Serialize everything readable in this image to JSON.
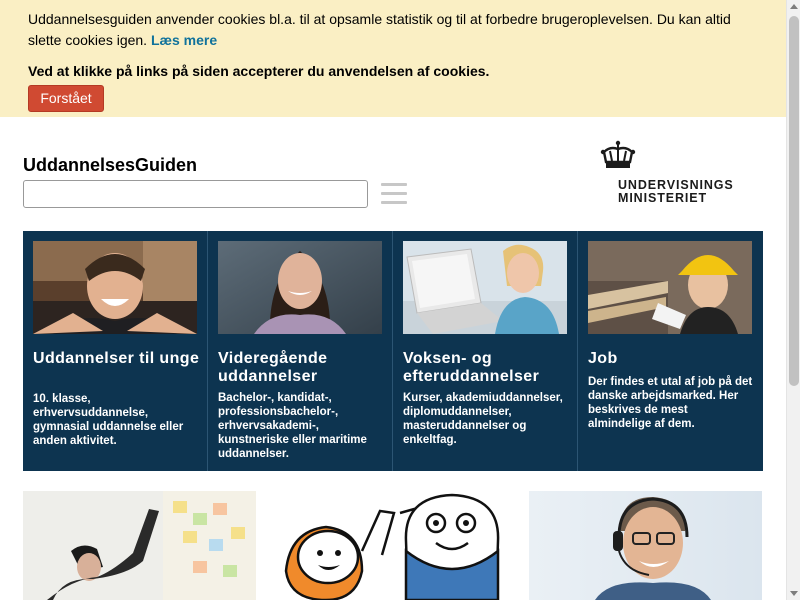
{
  "cookie_banner": {
    "message": "Uddannelsesguiden anvender cookies bl.a. til at opsamle statistik og til at forbedre brugeroplevelsen. Du kan altid slette cookies igen.",
    "read_more": "Læs mere",
    "accept_notice": "Ved at klikke på links på siden accepterer du anvendelsen af cookies.",
    "button_label": "Forstået"
  },
  "header": {
    "site_title": "UddannelsesGuiden",
    "search_value": "",
    "logo": {
      "line1": "UNDERVISNINGS",
      "line2": "MINISTERIET"
    }
  },
  "tiles": [
    {
      "title": "Uddannelser til unge",
      "description": "10. klasse, erhvervsuddannelse, gymnasial uddannelse eller anden aktivitet."
    },
    {
      "title": "Videregående uddannelser",
      "description": "Bachelor-, kandidat-, professionsbachelor-, erhvervsakademi-, kunstneriske eller maritime uddannelser."
    },
    {
      "title": "Voksen- og efteruddannelser",
      "description": "Kurser, akademiuddannelser, diplomuddannelser, masteruddannelser og enkeltfag."
    },
    {
      "title": "Job",
      "description": "Der findes et utal af job på det danske arbejdsmarked. Her beskrives de mest almindelige af dem."
    }
  ],
  "colors": {
    "banner_bg": "#faefc4",
    "accept_button": "#d04a32",
    "link": "#10729b",
    "tile_bg": "#0d3450"
  }
}
